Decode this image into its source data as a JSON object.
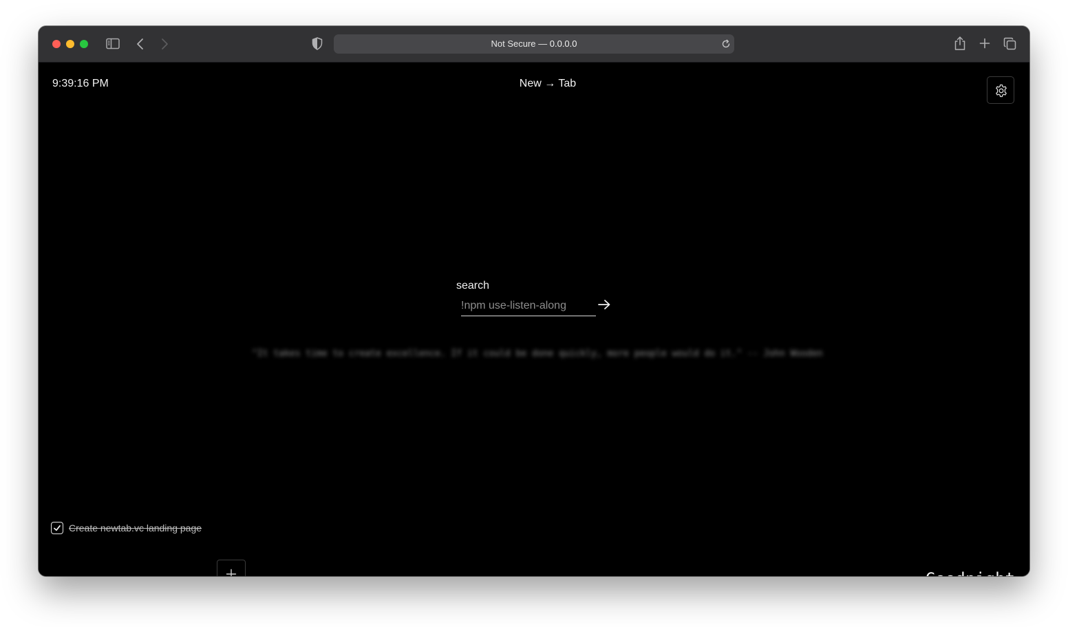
{
  "browser": {
    "address_prefix": "Not Secure — ",
    "address_host": "0.0.0.0",
    "icons": [
      "sidebar-icon",
      "back-icon",
      "forward-icon",
      "privacy-shield-icon",
      "reload-icon",
      "share-icon",
      "new-tab-icon",
      "tab-overview-icon"
    ]
  },
  "page": {
    "clock": "9:39:16 PM",
    "title": "New → Tab",
    "settings_icon": "gear-icon"
  },
  "search": {
    "label": "search",
    "placeholder": "!npm use-listen-along",
    "value": "",
    "submit_icon": "arrow-right-icon"
  },
  "quote": {
    "text": "\"It takes time to create excellence. If it could be done quickly, more people would do it.\" -- John Wooden"
  },
  "todos": {
    "items": [
      {
        "label": "Create newtab.vc landing page",
        "done": true
      }
    ],
    "add_icon": "plus-icon"
  },
  "greeting": "Goodnight",
  "colors": {
    "background": "#000000",
    "toolbar": "#323234",
    "text": "#f2f2f2",
    "border": "#3b3b3b"
  }
}
